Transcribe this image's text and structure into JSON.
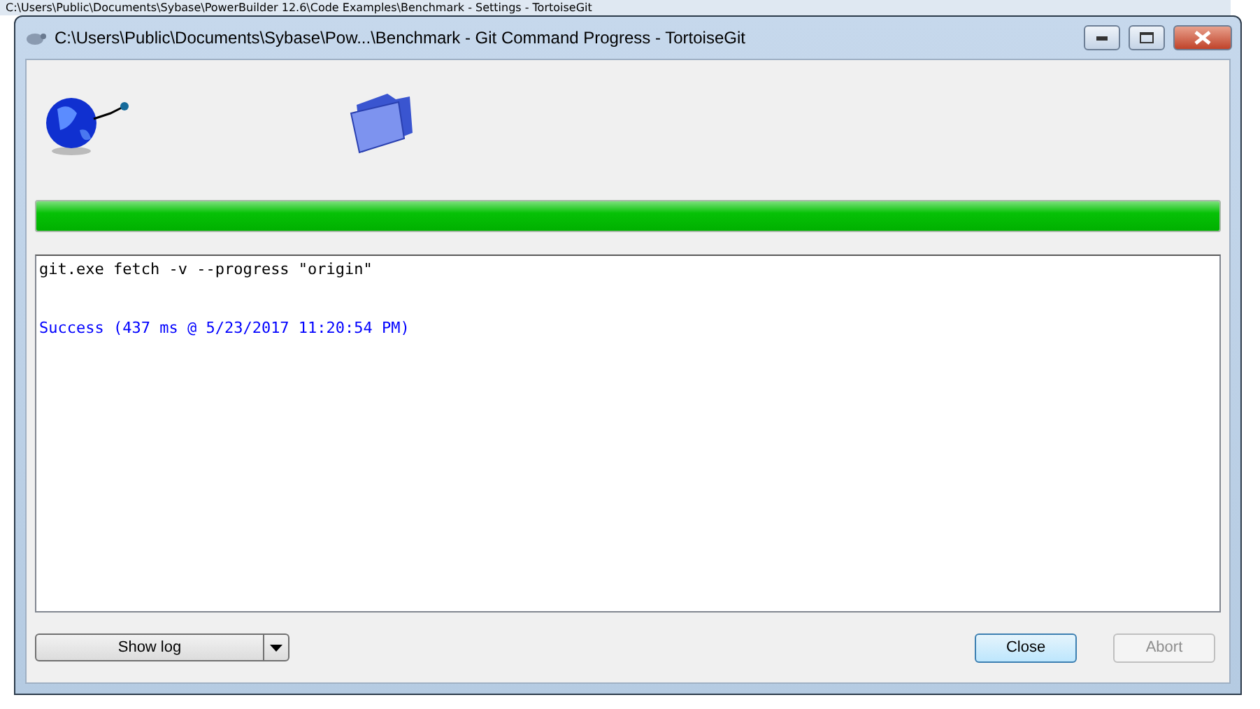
{
  "background_window": {
    "title": "C:\\Users\\Public\\Documents\\Sybase\\PowerBuilder 12.6\\Code Examples\\Benchmark - Settings - TortoiseGit"
  },
  "window": {
    "title": "C:\\Users\\Public\\Documents\\Sybase\\Pow...\\Benchmark - Git Command Progress - TortoiseGit"
  },
  "progress": {
    "level": 1
  },
  "log": [
    {
      "kind": "command",
      "text": "git.exe fetch -v --progress \"origin\""
    },
    {
      "kind": "success",
      "text": "Success (437 ms @ 5/23/2017 11:20:54 PM)"
    }
  ],
  "show_log_button": {
    "label": "Show log"
  },
  "buttons": [
    {
      "label": "Close",
      "default": true,
      "disabled": false
    },
    {
      "label": "Abort",
      "default": false,
      "disabled": true
    }
  ]
}
